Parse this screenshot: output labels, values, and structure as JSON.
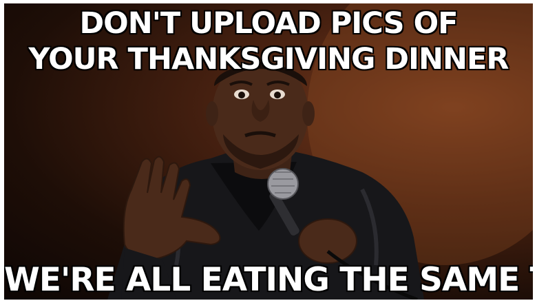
{
  "meme": {
    "top_line_1": "DON'T UPLOAD PICS OF",
    "top_line_2": "YOUR THANKSGIVING DINNER",
    "bottom_line": "WE'RE ALL EATING THE SAME THING"
  },
  "colors": {
    "background_glow": "#7a3d1f",
    "background_dark": "#0d0604",
    "caption_fill": "#ffffff",
    "caption_outline": "#000000",
    "jacket": "#1a1a1c",
    "skin": "#4a2a1a"
  }
}
